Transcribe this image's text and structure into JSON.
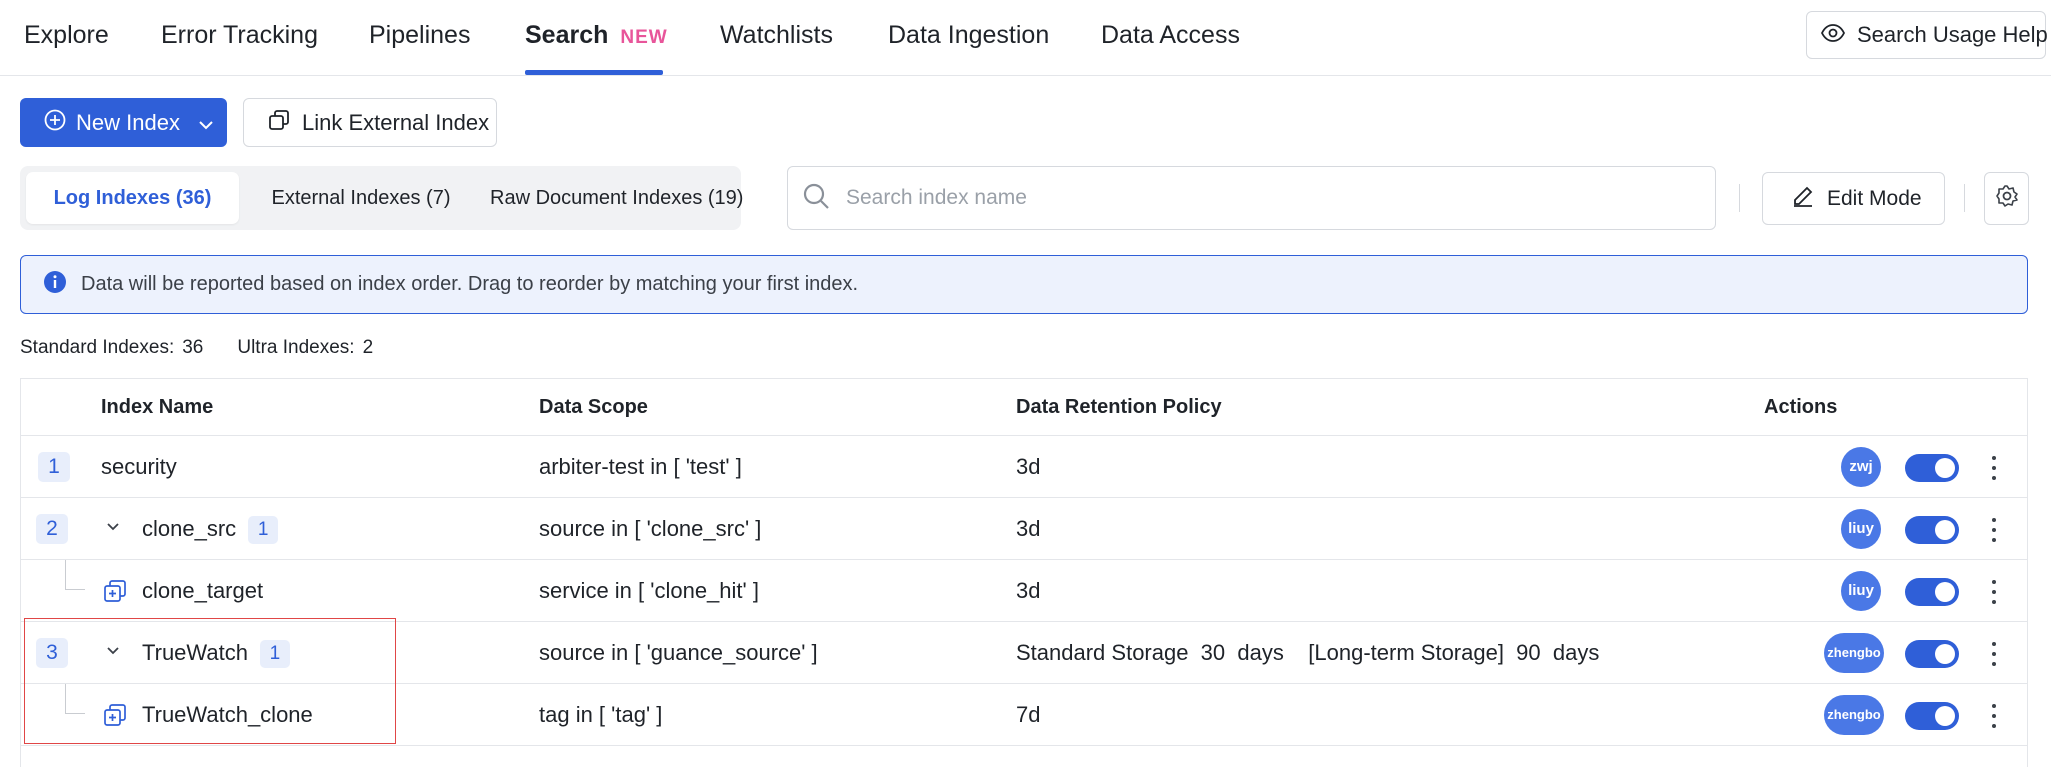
{
  "nav": {
    "items": [
      "Explore",
      "Error Tracking",
      "Pipelines",
      "Search",
      "Watchlists",
      "Data Ingestion",
      "Data Access"
    ],
    "active": "Search",
    "new_tag": "NEW",
    "help_label": "Search Usage Help"
  },
  "actions": {
    "new_index": "New Index",
    "link_external": "Link External Index"
  },
  "tabs": [
    "Log Indexes (36)",
    "External Indexes (7)",
    "Raw Document Indexes (19)"
  ],
  "search": {
    "placeholder": "Search index name"
  },
  "edit_mode": "Edit Mode",
  "info_text": "Data will be reported based on index order. Drag to reorder by matching your first index.",
  "counts": {
    "standard_label": "Standard Indexes:",
    "standard_value": "36",
    "ultra_label": "Ultra Indexes:",
    "ultra_value": "2"
  },
  "table": {
    "headers": [
      "Index Name",
      "Data Scope",
      "Data Retention Policy",
      "Actions"
    ],
    "rows": [
      {
        "num": "1",
        "name": "security",
        "scope": "arbiter-test in [ 'test' ]",
        "retention": "3d",
        "user": "zwj",
        "enabled": true
      },
      {
        "num": "2",
        "name": "clone_src",
        "count": "1",
        "scope": "source in [ 'clone_src' ]",
        "retention": "3d",
        "user": "liuy",
        "enabled": true
      },
      {
        "name": "clone_target",
        "scope": "service in [ 'clone_hit' ]",
        "retention": "3d",
        "user": "liuy",
        "enabled": true
      },
      {
        "num": "3",
        "name": "TrueWatch",
        "count": "1",
        "scope": "source in [ 'guance_source' ]",
        "retention": "Standard Storage  30  days    [Long-term Storage]  90  days",
        "user": "zhengbo",
        "enabled": true
      },
      {
        "name": "TrueWatch_clone",
        "scope": "tag in [ 'tag' ]",
        "retention": "7d",
        "user": "zhengbo",
        "enabled": true
      }
    ]
  },
  "colors": {
    "accent": "#2f5fd8",
    "new_tag": "#e8559a",
    "info_bg": "#edf2fd",
    "highlight": "#e04646"
  }
}
